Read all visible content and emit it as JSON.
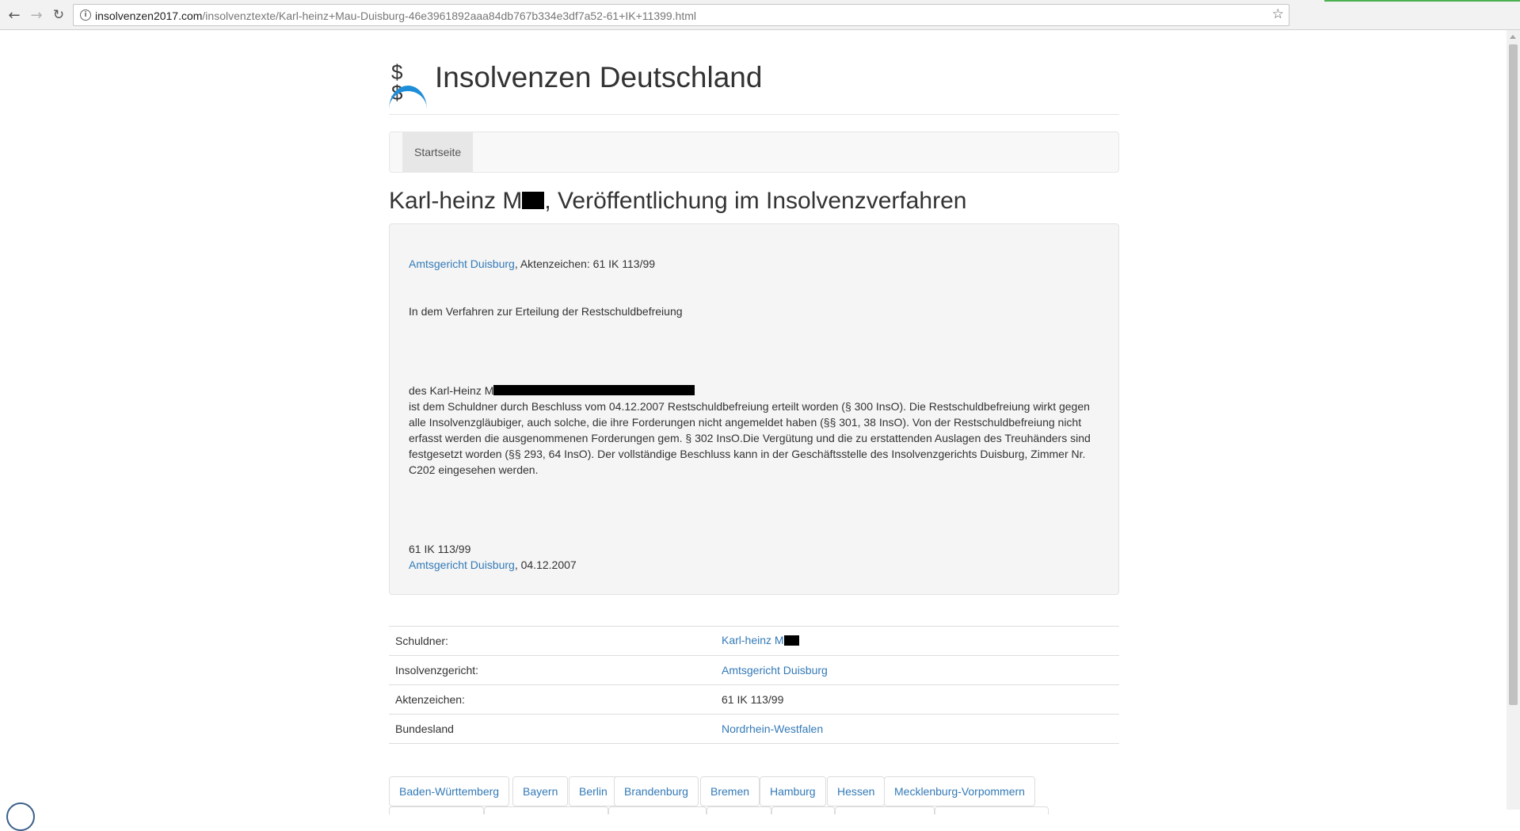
{
  "browser": {
    "url_host": "insolvenzen2017.com",
    "url_path": "/insolvenztexte/Karl-heinz+Mau-Duisburg-46e3961892aaa84db767b334e3df7a52-61+IK+11399.html",
    "back_icon": "arrow-left-icon",
    "forward_icon": "arrow-right-icon",
    "reload_icon": "reload-icon",
    "star_icon": "star-icon"
  },
  "site": {
    "logo_symbol": "$ $",
    "brand": "Insolvenzen Deutschland",
    "accent_color": "#1e8ed8",
    "link_color": "#337ab7"
  },
  "nav": {
    "home": "Startseite"
  },
  "page": {
    "title_prefix": "Karl-heinz M",
    "title_suffix": ", Veröffentlichung im Insolvenzverfahren"
  },
  "notice": {
    "court_link": "Amtsgericht Duisburg",
    "case_ref_text": ", Aktenzeichen: 61 IK 113/99",
    "intro": "In dem Verfahren zur Erteilung der Restschuldbefreiung",
    "debtor_prefix": "des Karl-Heinz M",
    "body": "ist dem Schuldner durch Beschluss vom 04.12.2007 Restschuldbefreiung erteilt worden (§ 300 InsO). Die Restschuldbefreiung wirkt gegen alle Insolvenzgläubiger, auch solche, die ihre Forderungen nicht angemeldet haben (§§ 301, 38 InsO). Von der Restschuldbefreiung nicht erfasst werden die ausgenommenen Forderungen gem. § 302 InsO.Die Vergütung und die zu erstattenden Auslagen des Treuhänders sind festgesetzt worden (§§ 293, 64 InsO). Der vollständige Beschluss kann in der Geschäftsstelle des Insolvenzgerichts Duisburg, Zimmer Nr. C202 eingesehen werden.",
    "footer_case": "61 IK 113/99",
    "footer_court_link": "Amtsgericht Duisburg",
    "footer_date": ", 04.12.2007"
  },
  "info_table": {
    "rows": [
      {
        "key": "Schuldner:",
        "value": "Karl-heinz M",
        "link": true,
        "redacted": true
      },
      {
        "key": "Insolvenzgericht:",
        "value": "Amtsgericht Duisburg",
        "link": true
      },
      {
        "key": "Aktenzeichen:",
        "value": "61 IK 113/99",
        "link": false
      },
      {
        "key": "Bundesland",
        "value": "Nordrhein-Westfalen",
        "link": true
      }
    ]
  },
  "states": [
    "Baden-Württemberg",
    "Bayern",
    "Berlin",
    "Brandenburg",
    "Bremen",
    "Hamburg",
    "Hessen",
    "Mecklenburg-Vorpommern"
  ]
}
